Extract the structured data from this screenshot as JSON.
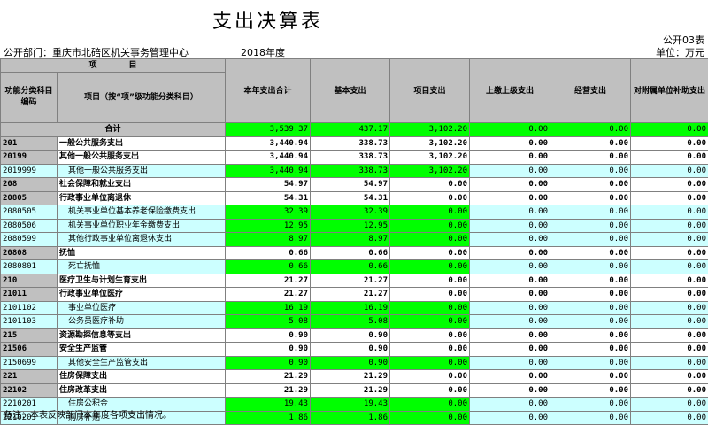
{
  "title": "支出决算表",
  "form_no": "公开03表",
  "department": "公开部门：重庆市北碚区机关事务管理中心",
  "year": "2018年度",
  "unit": "单位：万元",
  "headers": {
    "item_group": "项　　　　目",
    "code": "功能分类科目编码",
    "name": "项目（按“项”级功能分类科目）",
    "total": "本年支出合计",
    "basic": "基本支出",
    "project": "项目支出",
    "upper": "上缴上级支出",
    "business": "经营支出",
    "subsidy": "对附属单位补助支出"
  },
  "total_row": {
    "label": "合计",
    "total": "3,539.37",
    "basic": "437.17",
    "project": "3,102.20",
    "upper": "0.00",
    "business": "0.00",
    "subsidy": "0.00"
  },
  "rows": [
    {
      "type": "lvl",
      "code": "201",
      "name": "一般公共服务支出",
      "total": "3,440.94",
      "basic": "338.73",
      "project": "3,102.20",
      "upper": "0.00",
      "business": "0.00",
      "subsidy": "0.00"
    },
    {
      "type": "lvl",
      "code": "20199",
      "name": "其他一般公共服务支出",
      "total": "3,440.94",
      "basic": "338.73",
      "project": "3,102.20",
      "upper": "0.00",
      "business": "0.00",
      "subsidy": "0.00"
    },
    {
      "type": "sub",
      "code": "2019999",
      "name": "其他一般公共服务支出",
      "total": "3,440.94",
      "basic": "338.73",
      "project": "3,102.20",
      "upper": "0.00",
      "business": "0.00",
      "subsidy": "0.00"
    },
    {
      "type": "lvl",
      "code": "208",
      "name": "社会保障和就业支出",
      "total": "54.97",
      "basic": "54.97",
      "project": "0.00",
      "upper": "0.00",
      "business": "0.00",
      "subsidy": "0.00"
    },
    {
      "type": "lvl",
      "code": "20805",
      "name": "行政事业单位离退休",
      "total": "54.31",
      "basic": "54.31",
      "project": "0.00",
      "upper": "0.00",
      "business": "0.00",
      "subsidy": "0.00"
    },
    {
      "type": "sub",
      "code": "2080505",
      "name": "机关事业单位基本养老保险缴费支出",
      "total": "32.39",
      "basic": "32.39",
      "project": "0.00",
      "upper": "0.00",
      "business": "0.00",
      "subsidy": "0.00"
    },
    {
      "type": "sub",
      "code": "2080506",
      "name": "机关事业单位职业年金缴费支出",
      "total": "12.95",
      "basic": "12.95",
      "project": "0.00",
      "upper": "0.00",
      "business": "0.00",
      "subsidy": "0.00"
    },
    {
      "type": "sub",
      "code": "2080599",
      "name": "其他行政事业单位离退休支出",
      "total": "8.97",
      "basic": "8.97",
      "project": "0.00",
      "upper": "0.00",
      "business": "0.00",
      "subsidy": "0.00"
    },
    {
      "type": "lvl",
      "code": "20808",
      "name": "抚恤",
      "total": "0.66",
      "basic": "0.66",
      "project": "0.00",
      "upper": "0.00",
      "business": "0.00",
      "subsidy": "0.00"
    },
    {
      "type": "sub",
      "code": "2080801",
      "name": "死亡抚恤",
      "total": "0.66",
      "basic": "0.66",
      "project": "0.00",
      "upper": "0.00",
      "business": "0.00",
      "subsidy": "0.00"
    },
    {
      "type": "lvl",
      "code": "210",
      "name": "医疗卫生与计划生育支出",
      "total": "21.27",
      "basic": "21.27",
      "project": "0.00",
      "upper": "0.00",
      "business": "0.00",
      "subsidy": "0.00"
    },
    {
      "type": "lvl",
      "code": "21011",
      "name": "行政事业单位医疗",
      "total": "21.27",
      "basic": "21.27",
      "project": "0.00",
      "upper": "0.00",
      "business": "0.00",
      "subsidy": "0.00"
    },
    {
      "type": "sub",
      "code": "2101102",
      "name": "事业单位医疗",
      "total": "16.19",
      "basic": "16.19",
      "project": "0.00",
      "upper": "0.00",
      "business": "0.00",
      "subsidy": "0.00"
    },
    {
      "type": "sub",
      "code": "2101103",
      "name": "公务员医疗补助",
      "total": "5.08",
      "basic": "5.08",
      "project": "0.00",
      "upper": "0.00",
      "business": "0.00",
      "subsidy": "0.00"
    },
    {
      "type": "lvl",
      "code": "215",
      "name": "资源勘探信息等支出",
      "total": "0.90",
      "basic": "0.90",
      "project": "0.00",
      "upper": "0.00",
      "business": "0.00",
      "subsidy": "0.00"
    },
    {
      "type": "lvl",
      "code": "21506",
      "name": "安全生产监管",
      "total": "0.90",
      "basic": "0.90",
      "project": "0.00",
      "upper": "0.00",
      "business": "0.00",
      "subsidy": "0.00"
    },
    {
      "type": "sub",
      "code": "2150699",
      "name": "其他安全生产监管支出",
      "total": "0.90",
      "basic": "0.90",
      "project": "0.00",
      "upper": "0.00",
      "business": "0.00",
      "subsidy": "0.00"
    },
    {
      "type": "lvl",
      "code": "221",
      "name": "住房保障支出",
      "total": "21.29",
      "basic": "21.29",
      "project": "0.00",
      "upper": "0.00",
      "business": "0.00",
      "subsidy": "0.00"
    },
    {
      "type": "lvl",
      "code": "22102",
      "name": "住房改革支出",
      "total": "21.29",
      "basic": "21.29",
      "project": "0.00",
      "upper": "0.00",
      "business": "0.00",
      "subsidy": "0.00"
    },
    {
      "type": "sub",
      "code": "2210201",
      "name": "住房公积金",
      "total": "19.43",
      "basic": "19.43",
      "project": "0.00",
      "upper": "0.00",
      "business": "0.00",
      "subsidy": "0.00"
    },
    {
      "type": "sub",
      "code": "2210203",
      "name": "购房补贴",
      "total": "1.86",
      "basic": "1.86",
      "project": "0.00",
      "upper": "0.00",
      "business": "0.00",
      "subsidy": "0.00"
    }
  ],
  "note": "备注：本表反映部门本年度各项支出情况。"
}
